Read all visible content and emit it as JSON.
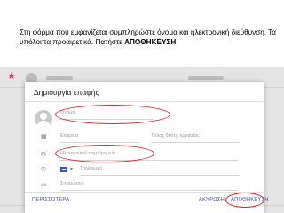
{
  "instruction": {
    "text_part1": "Στη φόρμα που εμφανίζεται συμπληρώστε όνομα και ηλεκτρονική διεύθυνση. Τα υπόλοιπα προαιρετικά. Πατήστε ",
    "text_bold": "ΑΠΟΘΗΚΕΥΣΗ",
    "text_end": "."
  },
  "dialog": {
    "title": "Δημιουργία επαφής",
    "fields": {
      "name_placeholder": "Όνομα",
      "company_placeholder": "Εταιρεία",
      "job_title_placeholder": "Τίτλος θέσης εργασίας",
      "email_placeholder": "Ηλεκτρονικό ταχυδρομείο",
      "phone_placeholder": "Τηλέφωνο",
      "notes_placeholder": "Σημειώσεις"
    },
    "buttons": {
      "more_label": "ΠΕΡΙΣΣΟΤΕΡΑ",
      "cancel_label": "ΑΚΥΡΩΣΗ",
      "save_label": "ΑΠΟΘΗΚΕΥΣΗ"
    }
  },
  "icons": {
    "star": "star-icon",
    "company": "building-icon",
    "email": "envelope-icon",
    "phone": "phone-icon",
    "notes": "note-icon",
    "flag": "greek-flag-icon"
  },
  "colors": {
    "accent": "#3f51b5",
    "annotation": "#e0202a",
    "star": "#e91e63"
  }
}
